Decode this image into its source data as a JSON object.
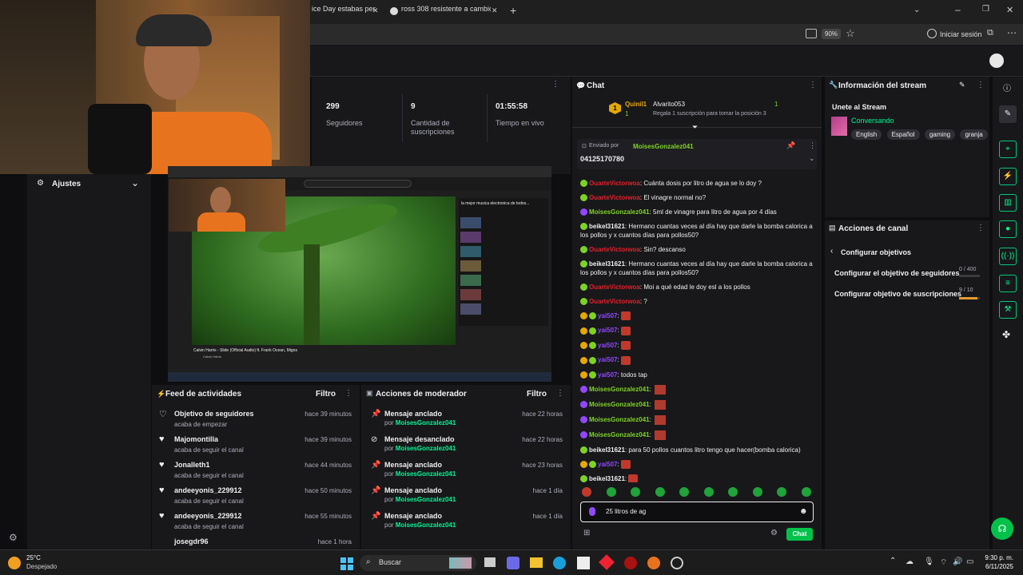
{
  "browser": {
    "tabs": [
      {
        "label": "ice Day estabas pen"
      },
      {
        "label": "ross 308 resistente a cambios cl"
      }
    ],
    "zoom": "90%",
    "signin": "Iniciar sesión"
  },
  "settings": {
    "label": "Ajustes"
  },
  "stats": [
    {
      "value": "299",
      "label": "Seguidores"
    },
    {
      "value": "9",
      "label": "Cantidad de suscripciones"
    },
    {
      "value": "01:55:58",
      "label": "Tiempo en vivo"
    }
  ],
  "preview": {
    "video_title": "Calvin Harris - Slide (Official Audio) ft. Frank Ocean, Migos",
    "channel": "Calvin Harris",
    "sidebar_title": "la mejor musica electronica de todos..."
  },
  "activity": {
    "title": "Feed de actividades",
    "filter": "Filtro",
    "items": [
      {
        "name": "Objetivo de seguidores",
        "desc": "acaba de empezar",
        "time": "hace 39 minutos"
      },
      {
        "name": "Majomontilla",
        "desc": "acaba de seguir el canal",
        "time": "hace 39 minutos"
      },
      {
        "name": "Jonalleth1",
        "desc": "acaba de seguir el canal",
        "time": "hace 44 minutos"
      },
      {
        "name": "andeeyonis_229912",
        "desc": "acaba de seguir el canal",
        "time": "hace 50 minutos"
      },
      {
        "name": "andeeyonis_229912",
        "desc": "acaba de seguir el canal",
        "time": "hace 55 minutos"
      },
      {
        "name": "josegdr96",
        "desc": "",
        "time": "hace 1 hora"
      }
    ]
  },
  "moderator": {
    "title": "Acciones de moderador",
    "filter": "Filtro",
    "by": "por",
    "items": [
      {
        "action": "Mensaje anclado",
        "user": "MoisesGonzalez041",
        "time": "hace 22 horas"
      },
      {
        "action": "Mensaje desanclado",
        "user": "MoisesGonzalez041",
        "time": "hace 22 horas"
      },
      {
        "action": "Mensaje anclado",
        "user": "MoisesGonzalez041",
        "time": "hace 23 horas"
      },
      {
        "action": "Mensaje anclado",
        "user": "MoisesGonzalez041",
        "time": "hace 1 día"
      },
      {
        "action": "Mensaje anclado",
        "user": "MoisesGonzalez041",
        "time": "hace 1 día"
      }
    ]
  },
  "chat": {
    "title": "Chat",
    "leaderboard": {
      "first": "Quinil1",
      "first_count": "1",
      "second": "Alvarito053",
      "second_count": "1",
      "prompt": "Regala 1 suscripción para tomar la posición 3"
    },
    "pinned": {
      "label": "Enviado por",
      "user": "MoisesGonzalez041",
      "message": "04125170780"
    },
    "messages": [
      {
        "user": "OuarteVictorwoa",
        "color": "#e0202a",
        "text": "Cuánta dosis por litro de agua se lo doy ?"
      },
      {
        "user": "OuarteVictorwoa",
        "color": "#e0202a",
        "text": "El vinagre normal no?"
      },
      {
        "user": "MoisesGonzalez041",
        "color": "#7ed321",
        "text": "5ml de vinagre para litro de agua por 4 días"
      },
      {
        "user": "beikel31621",
        "color": "#efeff1",
        "text": "Hermano cuantas veces al día hay que darle la bomba calorica a los pollos y x cuantos días para pollos50?"
      },
      {
        "user": "OuarteVictorwoa",
        "color": "#e0202a",
        "text": "Sin? descanso"
      },
      {
        "user": "beikel31621",
        "color": "#efeff1",
        "text": "Hermano cuantas veces al día hay que darle la bomba calorica a los pollos y x cuantos días para pollos50?"
      },
      {
        "user": "OuarteVictorwoa",
        "color": "#e0202a",
        "text": "Moi a qué edad le doy esl a los pollos"
      },
      {
        "user": "OuarteVictorwoa",
        "color": "#e0202a",
        "text": "?"
      },
      {
        "user": "yai507",
        "color": "#9147ff",
        "text": ""
      },
      {
        "user": "yai507",
        "color": "#9147ff",
        "text": ""
      },
      {
        "user": "yai507",
        "color": "#9147ff",
        "text": ""
      },
      {
        "user": "yai507",
        "color": "#9147ff",
        "text": ""
      },
      {
        "user": "yai507",
        "color": "#9147ff",
        "text": "todos tap"
      },
      {
        "user": "MoisesGonzalez041",
        "color": "#7ed321",
        "text": ""
      },
      {
        "user": "MoisesGonzalez041",
        "color": "#7ed321",
        "text": ""
      },
      {
        "user": "MoisesGonzalez041",
        "color": "#7ed321",
        "text": ""
      },
      {
        "user": "MoisesGonzalez041",
        "color": "#7ed321",
        "text": ""
      },
      {
        "user": "beikel31621",
        "color": "#efeff1",
        "text": "para 50 pollos cuantos litro tengo que hacer(bomba calorica)"
      },
      {
        "user": "yai507",
        "color": "#9147ff",
        "text": ""
      },
      {
        "user": "beikel31621",
        "color": "#efeff1",
        "text": ""
      }
    ],
    "input_value": "25 litros de ag",
    "send": "Chat"
  },
  "stream_info": {
    "title": "Información del stream",
    "stream_title": "Unete al Stream",
    "category": "Conversando",
    "tags": [
      "English",
      "Español",
      "gaming",
      "granja"
    ]
  },
  "channel_actions": {
    "title": "Acciones de canal",
    "back_label": "Configurar objetivos",
    "goals": [
      {
        "label": "Configurar el objetivo de seguidores",
        "progress": "0 / 400",
        "fraction": 0
      },
      {
        "label": "Configurar objetivo de suscripciones",
        "progress": "9 / 10",
        "fraction": 0.9
      }
    ]
  },
  "taskbar": {
    "weather_temp": "25°C",
    "weather_desc": "Despejado",
    "search": "Buscar",
    "time": "9:30 p. m.",
    "date": "6/11/2025"
  },
  "colors": {
    "accent": "#00f593",
    "twitch_green": "#00f593",
    "panel": "#18181b"
  }
}
